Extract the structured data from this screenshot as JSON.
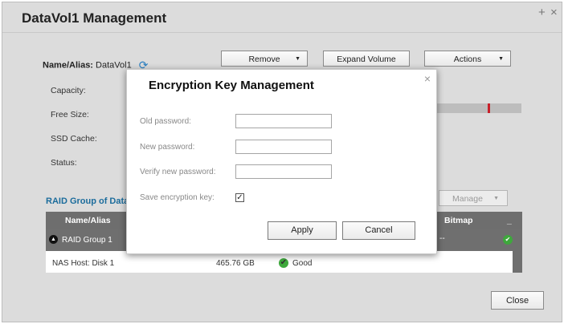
{
  "window": {
    "title": "DataVol1 Management",
    "controls": [
      "+",
      "×"
    ]
  },
  "volume": {
    "name_label": "Name/Alias:",
    "name_value": "DataVol1",
    "refresh_icon": "refresh-icon"
  },
  "toolbar": {
    "remove": "Remove",
    "expand": "Expand Volume",
    "actions": "Actions"
  },
  "info_labels": {
    "capacity": "Capacity:",
    "free_size": "Free Size:",
    "ssd_cache": "SSD Cache:",
    "status": "Status:"
  },
  "free_size_bar": {
    "marker_fraction": 0.6,
    "marker_color": "#c8202a"
  },
  "raid": {
    "title": "RAID Group of Data",
    "manage": "Manage",
    "headers": {
      "name": "Name/Alias",
      "bitmap": "Bitmap",
      "extra": "_"
    },
    "group_name": "RAID Group 1",
    "group_bitmap": "--",
    "disk_name": "NAS Host: Disk 1",
    "disk_size": "465.76 GB",
    "disk_status": "Good"
  },
  "footer": {
    "close": "Close"
  },
  "modal": {
    "title": "Encryption Key Management",
    "close_glyph": "×",
    "fields": {
      "old_password_label": "Old password:",
      "new_password_label": "New password:",
      "verify_password_label": "Verify new password:",
      "save_key_label": "Save encryption key:",
      "save_key_checked": "☑"
    },
    "apply": "Apply",
    "cancel": "Cancel"
  },
  "colors": {
    "accent": "#1b6c9c",
    "ok": "#3ea83c",
    "header_bg": "#6e6e6e"
  }
}
